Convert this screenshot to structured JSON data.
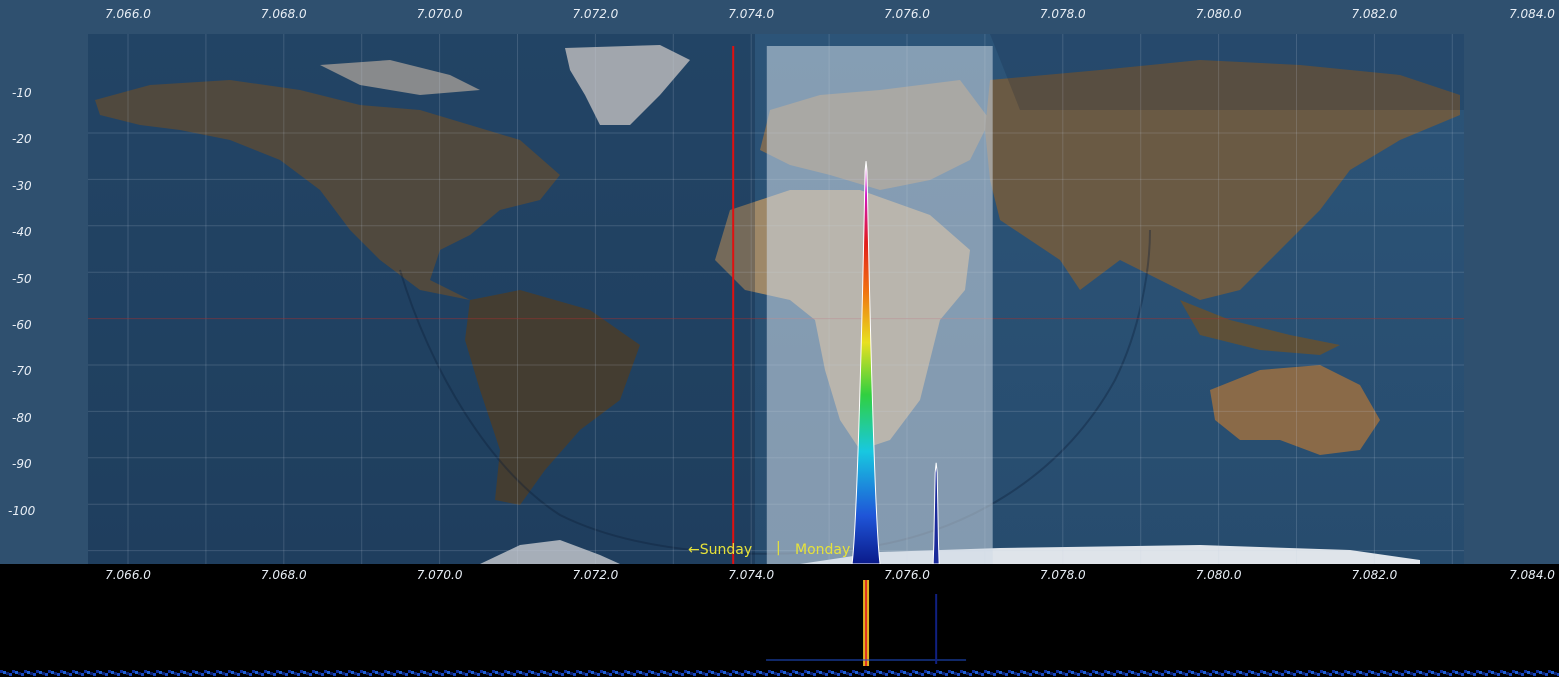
{
  "app": {
    "view": "spectrum-and-waterfall"
  },
  "frequency_axis": {
    "labels": [
      "7.066.0",
      "7.068.0",
      "7.070.0",
      "7.072.0",
      "7.074.0",
      "7.076.0",
      "7.078.0",
      "7.080.0",
      "7.082.0",
      "7.084.0"
    ]
  },
  "level_axis": {
    "labels": [
      "-10",
      "-20",
      "-30",
      "-40",
      "-50",
      "-60",
      "-70",
      "-80",
      "-90",
      "-100"
    ]
  },
  "map_overlay": {
    "day_left": "←Sunday",
    "day_separator": "|",
    "day_right": "Monday"
  },
  "colors": {
    "background": "#2f506f",
    "tuning_marker": "#e01010",
    "passband": "#cfdbe6",
    "day_label": "#e6e23a"
  },
  "signals": [
    {
      "freq_khz": 7075.5,
      "level_db": -29
    },
    {
      "freq_khz": 7076.4,
      "level_db": -94
    }
  ],
  "tuning": {
    "marker_freq_khz": 7074.0,
    "passband_start_khz": 7074.2,
    "passband_end_khz": 7077.1
  }
}
